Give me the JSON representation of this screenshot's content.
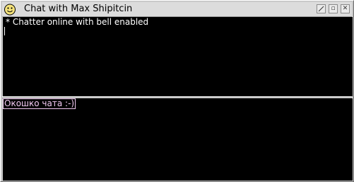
{
  "window": {
    "title": "Chat with Max Shipitcin",
    "icon": "smiley-face-icon",
    "controls": {
      "shade_icon": "slash-box-icon",
      "minimize_label": "▫",
      "close_label": "✕"
    }
  },
  "chat": {
    "lines": [
      "* Chatter online with bell enabled"
    ]
  },
  "input": {
    "value": "Окошко чата :-)"
  },
  "colors": {
    "chat_bg": "#000000",
    "chat_text": "#ffffff",
    "input_text": "#f2c9f2"
  }
}
